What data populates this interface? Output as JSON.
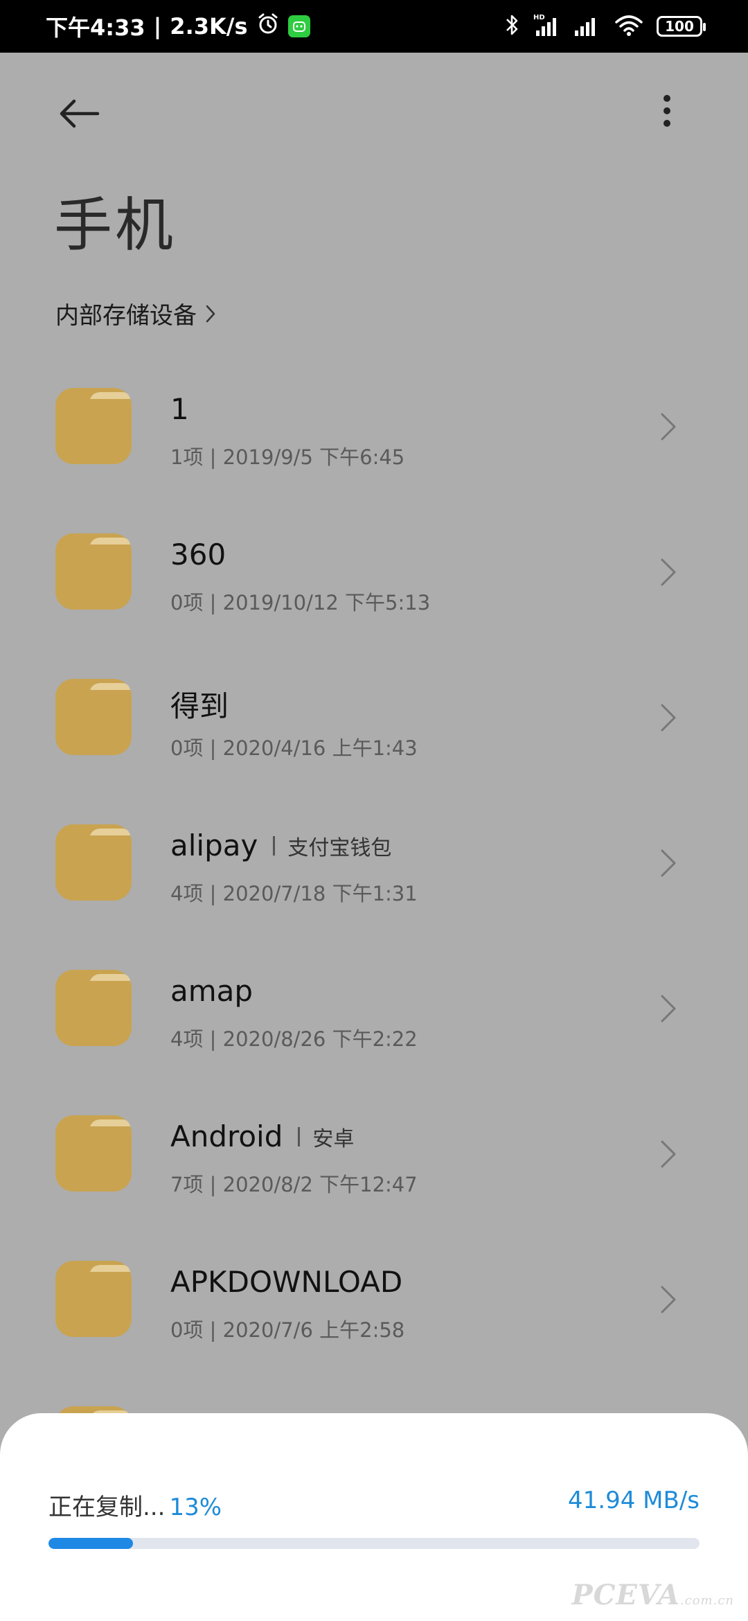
{
  "status_bar": {
    "time": "下午4:33",
    "separator": "|",
    "net_speed": "2.3K/s",
    "battery": "100"
  },
  "header": {
    "title": "手机",
    "breadcrumb": "内部存储设备"
  },
  "folders": [
    {
      "name": "1",
      "alias": "",
      "meta": "1项  |  2019/9/5 下午6:45"
    },
    {
      "name": "360",
      "alias": "",
      "meta": "0项  |  2019/10/12 下午5:13"
    },
    {
      "name": "得到",
      "alias": "",
      "meta": "0项  |  2020/4/16 上午1:43"
    },
    {
      "name": "alipay",
      "alias": "支付宝钱包",
      "meta": "4项  |  2020/7/18 下午1:31"
    },
    {
      "name": "amap",
      "alias": "",
      "meta": "4项  |  2020/8/26 下午2:22"
    },
    {
      "name": "Android",
      "alias": "安卓",
      "meta": "7项  |  2020/8/2 下午12:47"
    },
    {
      "name": "APKDOWNLOAD",
      "alias": "",
      "meta": "0项  |  2020/7/6 上午2:58"
    }
  ],
  "copy_sheet": {
    "label": "正在复制...",
    "percent_text": "13%",
    "progress": 0.13,
    "speed": "41.94 MB/s"
  },
  "watermark": {
    "brand": "PCEVA",
    "suffix": ".com.cn"
  },
  "colors": {
    "folder": "#c9a350",
    "accent": "#1e88e5",
    "overlay_bg": "#adadad"
  }
}
